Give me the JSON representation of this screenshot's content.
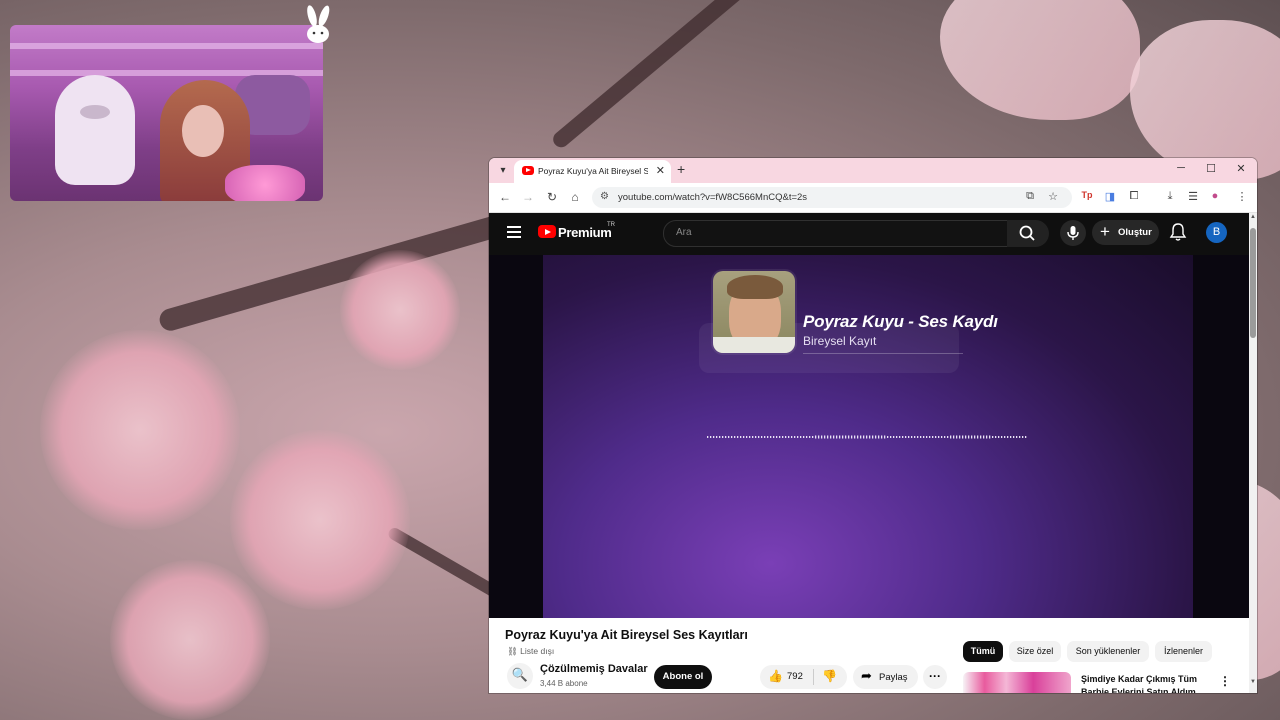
{
  "browser": {
    "tab_title": "Poyraz Kuyu'ya Ait Bireysel Ses Kayıtları",
    "url": "youtube.com/watch?v=fW8C566MnCQ&t=2s"
  },
  "youtube": {
    "brand": "Premium",
    "region": "TR",
    "search_placeholder": "Ara",
    "create_label": "Oluştur",
    "avatar_letter": "B",
    "player": {
      "card_title": "Poyraz Kuyu - Ses Kaydı",
      "card_subtitle": "Bireysel Kayıt"
    },
    "video": {
      "title": "Poyraz Kuyu'ya Ait Bireysel Ses Kayıtları",
      "visibility": "Liste dışı",
      "channel_name": "Çözülmemiş Davalar",
      "subscribers": "3,44 B abone",
      "subscribe_label": "Abone ol",
      "likes": "792",
      "share_label": "Paylaş"
    },
    "chips": [
      "Tümü",
      "Size özel",
      "Son yüklenenler",
      "İzlenenler"
    ],
    "recommendation_title": "Şimdiye Kadar Çıkmış Tüm Barbie Evlerini Satın Aldım"
  },
  "colors": {
    "tabbar": "#f8d7e1",
    "yt_red": "#ff0000",
    "player_purple": "#4f2b8a"
  }
}
